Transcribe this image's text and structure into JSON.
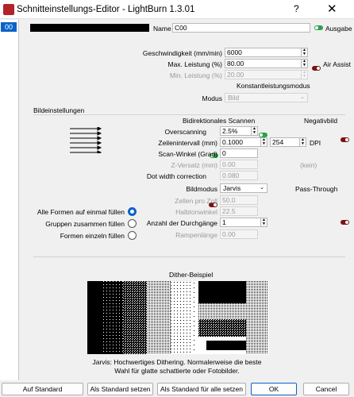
{
  "window": {
    "title": "Schnitteinstellungs-Editor - LightBurn 1.3.01",
    "help": "?",
    "close": "✕"
  },
  "left": {
    "selected": "00"
  },
  "top": {
    "name_label": "Name",
    "name_value": "C00",
    "output_label": "Ausgabe",
    "speed_label": "Geschwindigkeit (mm/min)",
    "speed_value": "6000",
    "maxpower_label": "Max. Leistung (%)",
    "maxpower_value": "80.00",
    "airassist_label": "Air Assist",
    "minpower_label": "Min. Leistung (%)",
    "minpower_value": "20.00",
    "constpower_label": "Konstantleistungsmodus",
    "mode_label": "Modus",
    "mode_value": "Bild"
  },
  "image": {
    "section_title": "Bildeinstellungen",
    "bidir_label": "Bidirektionales Scannen",
    "negative_label": "Negativbild",
    "overscan_label": "Overscanning",
    "overscan_value": "2.5%",
    "interval_label": "Zeilenintervall (mm)",
    "interval_value": "0.1000",
    "dpi_value": "254",
    "dpi_label": "DPI",
    "angle_label": "Scan-Winkel (Grad)",
    "angle_value": "0",
    "zoffset_label": "Z-Versatz (mm)",
    "zoffset_value": "0.00",
    "zoffset_note": "(kein)",
    "dotwidth_label": "Dot width correction",
    "dotwidth_value": "0.080",
    "imagemode_label": "Bildmodus",
    "imagemode_value": "Jarvis",
    "passthrough_label": "Pass-Through",
    "lpi_label": "Zellen pro Zoll",
    "lpi_value": "50.0",
    "halftone_label": "Halbtonwinkel",
    "halftone_value": "22.5",
    "passes_label": "Anzahl der Durchgänge",
    "passes_value": "1",
    "ramp_label": "Rampenlänge",
    "ramp_value": "0.00",
    "radio_all": "Alle Formen auf einmal füllen",
    "radio_groups": "Gruppen zusammen füllen",
    "radio_single": "Formen einzeln füllen"
  },
  "dither": {
    "title": "Dither-Beispiel",
    "desc_line1": "Jarvis: Hochwertiges Dithering. Normalerweise die beste",
    "desc_line2": "Wahl für glatte schattierte oder Fotobilder."
  },
  "buttons": {
    "reset": "Auf Standard zurücksetzen",
    "set_default": "Als Standard setzen",
    "set_all": "Als Standard für alle setzen",
    "ok": "OK",
    "cancel": "Cancel"
  },
  "colors": {
    "accent": "#0a62c7",
    "toggle_on": "#2aa24a",
    "toggle_off": "#7a1414"
  }
}
